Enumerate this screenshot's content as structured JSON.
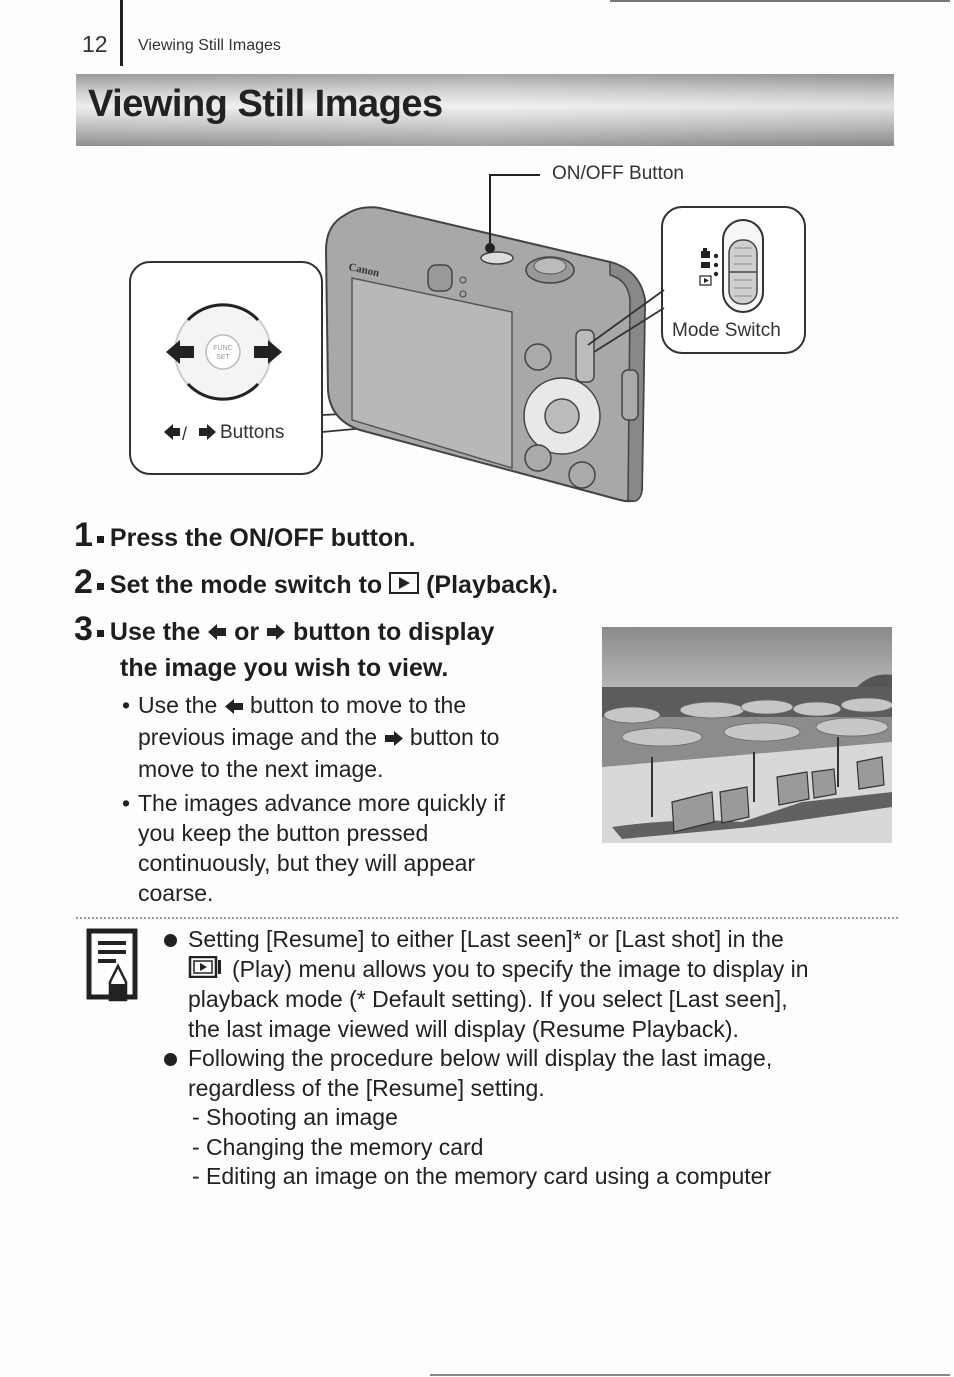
{
  "header": {
    "page_number": "12",
    "section": "Viewing Still Images"
  },
  "title": "Viewing Still Images",
  "figure": {
    "onoff_label": "ON/OFF Button",
    "mode_switch_label": "Mode Switch",
    "buttons_label": "Buttons",
    "buttons_separator": "/",
    "camera_brand": "Canon",
    "dial_center_label": "FUNC SET"
  },
  "steps": [
    {
      "number": "1",
      "text": "Press the ON/OFF button."
    },
    {
      "number": "2",
      "text_before": "Set the mode switch to",
      "text_after": "(Playback)."
    },
    {
      "number": "3",
      "text_part1": "Use the",
      "text_part2": "or",
      "text_part3": "button to display",
      "text_line2": "the image you wish to view."
    }
  ],
  "step3_bullets": {
    "b1_part1": "Use the",
    "b1_part2": "button to move to the",
    "b1_line2_part1": "previous image and the",
    "b1_line2_part2": "button to",
    "b1_line3": "move to the next image.",
    "b2_line1": "The images advance more quickly if",
    "b2_line2": "you keep the button pressed",
    "b2_line3": "continuously, but they will appear",
    "b2_line4": "coarse."
  },
  "note": {
    "item1_line1": "Setting [Resume] to either [Last seen]* or [Last shot] in the",
    "item1_line2": "(Play) menu allows you to specify the image to display in",
    "item1_line3": "playback mode (* Default setting). If you select [Last seen],",
    "item1_line4": "the last image viewed will display (Resume Playback).",
    "item2_line1": "Following the procedure below will display the last image,",
    "item2_line2": "regardless of the [Resume] setting.",
    "sub_items": [
      "- Shooting an image",
      "- Changing the memory card",
      "- Editing an image on the memory card using a computer"
    ]
  },
  "icons": {
    "left_arrow": "left-arrow-icon",
    "right_arrow": "right-arrow-icon",
    "playback": "playback-icon",
    "memo": "memo-pencil-icon"
  }
}
